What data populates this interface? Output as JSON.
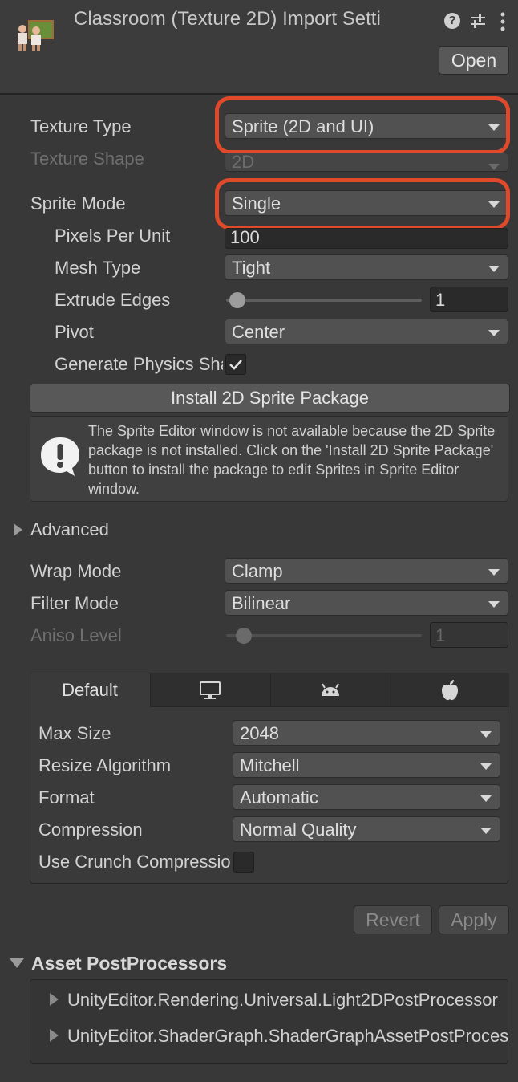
{
  "header": {
    "title": "Classroom (Texture 2D) Import Setti",
    "open_label": "Open",
    "icons": [
      "classroom-asset-icon",
      "help-icon",
      "preset-sliders-icon",
      "kebab-menu-icon"
    ]
  },
  "texture": {
    "texture_type_label": "Texture Type",
    "texture_type_value": "Sprite (2D and UI)",
    "texture_shape_label": "Texture Shape",
    "texture_shape_value": "2D",
    "sprite_mode_label": "Sprite Mode",
    "sprite_mode_value": "Single",
    "pixels_per_unit_label": "Pixels Per Unit",
    "pixels_per_unit_value": "100",
    "mesh_type_label": "Mesh Type",
    "mesh_type_value": "Tight",
    "extrude_edges_label": "Extrude Edges",
    "extrude_edges_value": "1",
    "pivot_label": "Pivot",
    "pivot_value": "Center",
    "generate_physics_label": "Generate Physics Shape",
    "generate_physics_checked": true,
    "install_button": "Install 2D Sprite Package",
    "help_message": "The Sprite Editor window is not available because the 2D Sprite package is not installed. Click on the 'Install 2D Sprite Package' button to install the package to edit Sprites in Sprite Editor window."
  },
  "advanced": {
    "label": "Advanced",
    "wrap_mode_label": "Wrap Mode",
    "wrap_mode_value": "Clamp",
    "filter_mode_label": "Filter Mode",
    "filter_mode_value": "Bilinear",
    "aniso_level_label": "Aniso Level",
    "aniso_level_value": "1"
  },
  "platform": {
    "tabs": [
      {
        "label": "Default",
        "icon": null
      },
      {
        "label": "",
        "icon": "monitor-icon"
      },
      {
        "label": "",
        "icon": "android-icon"
      },
      {
        "label": "",
        "icon": "apple-icon"
      }
    ],
    "max_size_label": "Max Size",
    "max_size_value": "2048",
    "resize_label": "Resize Algorithm",
    "resize_value": "Mitchell",
    "format_label": "Format",
    "format_value": "Automatic",
    "compression_label": "Compression",
    "compression_value": "Normal Quality",
    "crunch_label": "Use Crunch Compression",
    "crunch_checked": false
  },
  "footer": {
    "revert_label": "Revert",
    "apply_label": "Apply"
  },
  "postprocessors": {
    "title": "Asset PostProcessors",
    "items": [
      "UnityEditor.Rendering.Universal.Light2DPostProcessor",
      "UnityEditor.ShaderGraph.ShaderGraphAssetPostProcessor"
    ]
  },
  "colors": {
    "highlight": "#e04a2a",
    "panel": "#383838"
  }
}
